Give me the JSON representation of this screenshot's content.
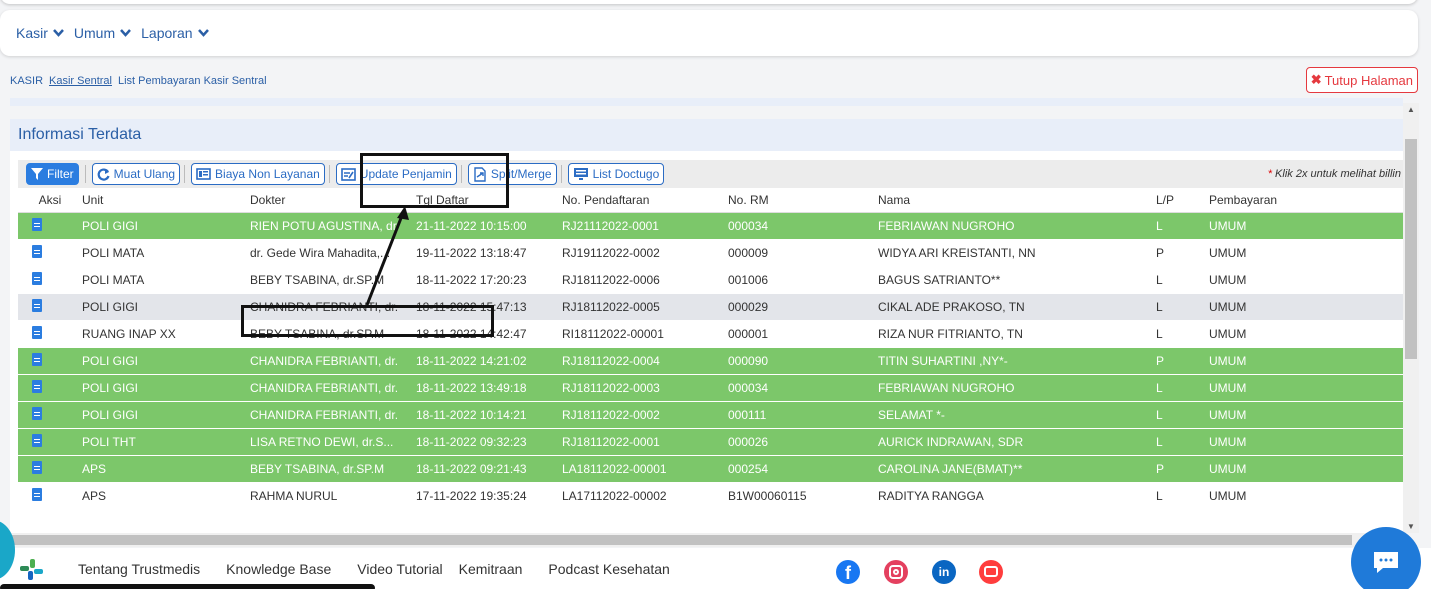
{
  "menu": [
    "Kasir",
    "Umum",
    "Laporan"
  ],
  "breadcrumb": {
    "root": "KASIR",
    "link": "Kasir Sentral",
    "current": "List Pembayaran Kasir Sentral"
  },
  "close_button": "Tutup Halaman",
  "panel_title": "Informasi Terdata",
  "toolbar": {
    "filter": "Filter",
    "reload": "Muat Ulang",
    "non_service_fee": "Biaya Non Layanan",
    "update_guarantor": "Update Penjamin",
    "split_merge": "Split/Merge",
    "list_doctugo": "List Doctugo",
    "hint_star": "*",
    "hint": "Klik 2x untuk melihat billin"
  },
  "table": {
    "columns": [
      "Aksi",
      "Unit",
      "Dokter",
      "Tgl Daftar",
      "No. Pendaftaran",
      "No. RM",
      "Nama",
      "L/P",
      "Pembayaran"
    ],
    "rows": [
      {
        "style": "green",
        "cells": [
          "POLI GIGI",
          "RIEN POTU AGUSTINA, dr",
          "21-11-2022 10:15:00",
          "RJ21112022-0001",
          "000034",
          "FEBRIAWAN NUGROHO",
          "L",
          "UMUM"
        ]
      },
      {
        "style": "white",
        "cells": [
          "POLI MATA",
          "dr. Gede Wira Mahadita,...",
          "19-11-2022 13:18:47",
          "RJ19112022-0002",
          "000009",
          "WIDYA ARI KREISTANTI, NN",
          "P",
          "UMUM"
        ]
      },
      {
        "style": "white",
        "cells": [
          "POLI MATA",
          "BEBY TSABINA, dr.SP.M",
          "18-11-2022 17:20:23",
          "RJ18112022-0006",
          "001006",
          "BAGUS SATRIANTO**",
          "L",
          "UMUM"
        ]
      },
      {
        "style": "grey",
        "cells": [
          "POLI GIGI",
          "CHANIDRA FEBRIANTI, dr.",
          "18-11-2022 15:47:13",
          "RJ18112022-0005",
          "000029",
          "CIKAL ADE PRAKOSO, TN",
          "L",
          "UMUM"
        ]
      },
      {
        "style": "white",
        "cells": [
          "RUANG INAP XX",
          "BEBY TSABINA, dr.SP.M",
          "18-11-2022 14:42:47",
          "RI18112022-00001",
          "000001",
          "RIZA NUR FITRIANTO, TN",
          "L",
          "UMUM"
        ]
      },
      {
        "style": "green",
        "cells": [
          "POLI GIGI",
          "CHANIDRA FEBRIANTI, dr.",
          "18-11-2022 14:21:02",
          "RJ18112022-0004",
          "000090",
          "TITIN SUHARTINI ,NY*-",
          "P",
          "UMUM"
        ]
      },
      {
        "style": "green",
        "cells": [
          "POLI GIGI",
          "CHANIDRA FEBRIANTI, dr.",
          "18-11-2022 13:49:18",
          "RJ18112022-0003",
          "000034",
          "FEBRIAWAN NUGROHO",
          "L",
          "UMUM"
        ]
      },
      {
        "style": "green",
        "cells": [
          "POLI GIGI",
          "CHANIDRA FEBRIANTI, dr.",
          "18-11-2022 10:14:21",
          "RJ18112022-0002",
          "000111",
          "SELAMAT *-",
          "L",
          "UMUM"
        ]
      },
      {
        "style": "green",
        "cells": [
          "POLI THT",
          "LISA RETNO DEWI, dr.S...",
          "18-11-2022 09:32:23",
          "RJ18112022-0001",
          "000026",
          "AURICK INDRAWAN, SDR",
          "L",
          "UMUM"
        ]
      },
      {
        "style": "green",
        "cells": [
          "APS",
          "BEBY TSABINA, dr.SP.M",
          "18-11-2022 09:21:43",
          "LA18112022-00001",
          "000254",
          "CAROLINA JANE(BMAT)**",
          "P",
          "UMUM"
        ]
      },
      {
        "style": "white",
        "cells": [
          "APS",
          "RAHMA NURUL",
          "17-11-2022 19:35:24",
          "LA17112022-00002",
          "B1W00060115",
          "RADITYA RANGGA",
          "L",
          "UMUM"
        ]
      }
    ]
  },
  "footer": {
    "links": [
      "Tentang Trustmedis",
      "Knowledge Base",
      "Video Tutorial",
      "Kemitraan",
      "Podcast Kesehatan"
    ],
    "social": [
      "facebook-icon",
      "instagram-icon",
      "linkedin-icon",
      "youtube-icon"
    ]
  },
  "colors": {
    "accent": "#2b5fa6",
    "row_green": "#7cc76a",
    "close_red": "#e5393f",
    "chat_blue": "#1f7ad9"
  }
}
